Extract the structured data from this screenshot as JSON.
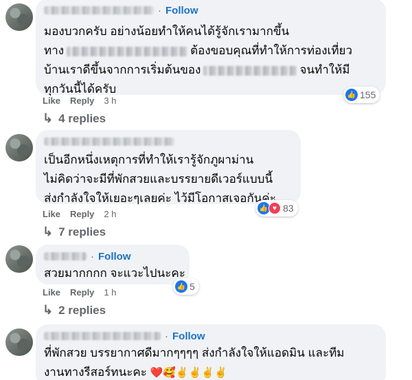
{
  "comments": [
    {
      "follow": "Follow",
      "lines": [
        [
          "มองบวกครับ อย่างน้อยทำให้คนได้รู้จักเรามากขึ้น"
        ],
        [
          "ทาง",
          "ต้องขอบคุณที่ทำให้การท่องเที่ยว"
        ],
        [
          "บ้านเราดีขึ้นจากการเริ่มต้นของ",
          "จนทำให้มี"
        ],
        [
          "ทุกวันนี้ได้ครับ"
        ]
      ],
      "reactions": {
        "icons": [
          "like-icon"
        ],
        "count": "155"
      },
      "actions": {
        "like": "Like",
        "reply": "Reply",
        "time": "3 h"
      },
      "replies": "4 replies"
    },
    {
      "follow": "",
      "lines": [
        [
          "เป็นอีกหนึ่งเหตุการที่ทำให้เรารู้จักภูผาม่าน"
        ],
        [
          "ไม่คิดว่าจะมีที่พักสวยและบรรยายดีเวอร์แบบนี้"
        ],
        [
          "ส่งกำลังใจให้เยอะๆเลยค่ะ ไว้มีโอกาสเจอกันค่ะ"
        ]
      ],
      "reactions": {
        "icons": [
          "like-icon",
          "love-icon"
        ],
        "count": "83"
      },
      "actions": {
        "like": "Like",
        "reply": "Reply",
        "time": "2 h"
      },
      "replies": "7 replies"
    },
    {
      "follow": "Follow",
      "lines": [
        [
          "สวยมากกกก จะแวะไปนะคะ"
        ]
      ],
      "reactions": {
        "icons": [
          "like-icon"
        ],
        "count": "5"
      },
      "actions": {
        "like": "Like",
        "reply": "Reply",
        "time": "1 h"
      },
      "replies": "2 replies"
    },
    {
      "follow": "Follow",
      "lines": [
        [
          "ที่พักสวย บรรยากาศดีมากๆๆๆๆ ส่งกำลังใจให้แอดมิน และทีม"
        ],
        [
          "งานทางรีสอร์ทนะคะ"
        ]
      ],
      "emojis": "❤️🥰✌️✌️✌️✌️"
    }
  ],
  "colors": {
    "accent": "#1a73c8",
    "like": "#1877f2",
    "love": "#f33e58",
    "bubble": "#f0f2f5",
    "muted": "#65676b"
  }
}
